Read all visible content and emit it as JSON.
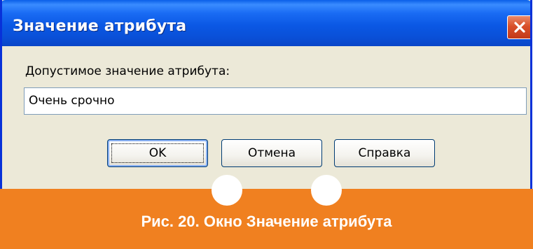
{
  "window": {
    "title": "Значение атрибута",
    "close_icon": "close-icon"
  },
  "form": {
    "prompt_label": "Допустимое значение атрибута:",
    "value": "Очень срочно"
  },
  "buttons": {
    "ok_label": "OK",
    "cancel_label": "Отмена",
    "help_label": "Справка"
  },
  "caption": {
    "text": "Рис. 20. Окно Значение атрибута"
  },
  "colors": {
    "titlebar": "#0a58e4",
    "window_bg": "#ece9d8",
    "close_button": "#d9502a",
    "banner": "#f08020"
  }
}
